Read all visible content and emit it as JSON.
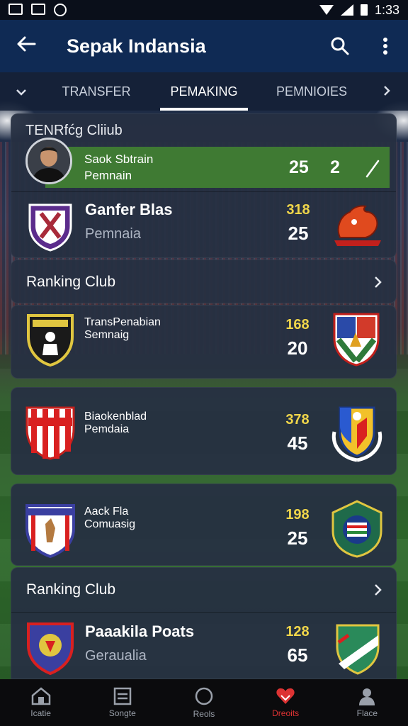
{
  "status_bar": {
    "time": "1:33"
  },
  "app_bar": {
    "title": "Sepak Indansia"
  },
  "tabs": [
    {
      "label": "TRANSFER"
    },
    {
      "label": "PEMAKING"
    },
    {
      "label": "PEMNIOIES"
    }
  ],
  "transfer_card": {
    "title": "TENRfćg Cliiub",
    "highlight": {
      "line1": "Saok Sbtrain",
      "line2": "Pemnain",
      "value1": "25",
      "value2": "2"
    },
    "row": {
      "name": "Ganfer Blas",
      "sub": "Pemnaia",
      "value1": "318",
      "value2": "25"
    }
  },
  "ranking_section_1": {
    "title": "Ranking Club",
    "rows": [
      {
        "name": "TransPenabian",
        "sub": "Semnaig",
        "value1": "168",
        "value2": "20"
      },
      {
        "name": "Biaokenblad",
        "sub": "Pemdaia",
        "value1": "378",
        "value2": "45"
      },
      {
        "name": "Aack Fla",
        "sub": "Comuasig",
        "value1": "198",
        "value2": "25"
      }
    ]
  },
  "ranking_section_2": {
    "title": "Ranking Club",
    "rows": [
      {
        "name": "Paaakila Poats",
        "sub": "Geraualia",
        "value1": "128",
        "value2": "65"
      }
    ]
  },
  "bottom_nav": [
    {
      "label": "Icatie"
    },
    {
      "label": "Songte"
    },
    {
      "label": "Reols"
    },
    {
      "label": "Dreoits"
    },
    {
      "label": "Flace"
    }
  ],
  "colors": {
    "accent_green": "#3f7a33",
    "value_yellow": "#f0d64a",
    "app_bar": "#0f2a54",
    "active_nav": "#dd3333"
  }
}
